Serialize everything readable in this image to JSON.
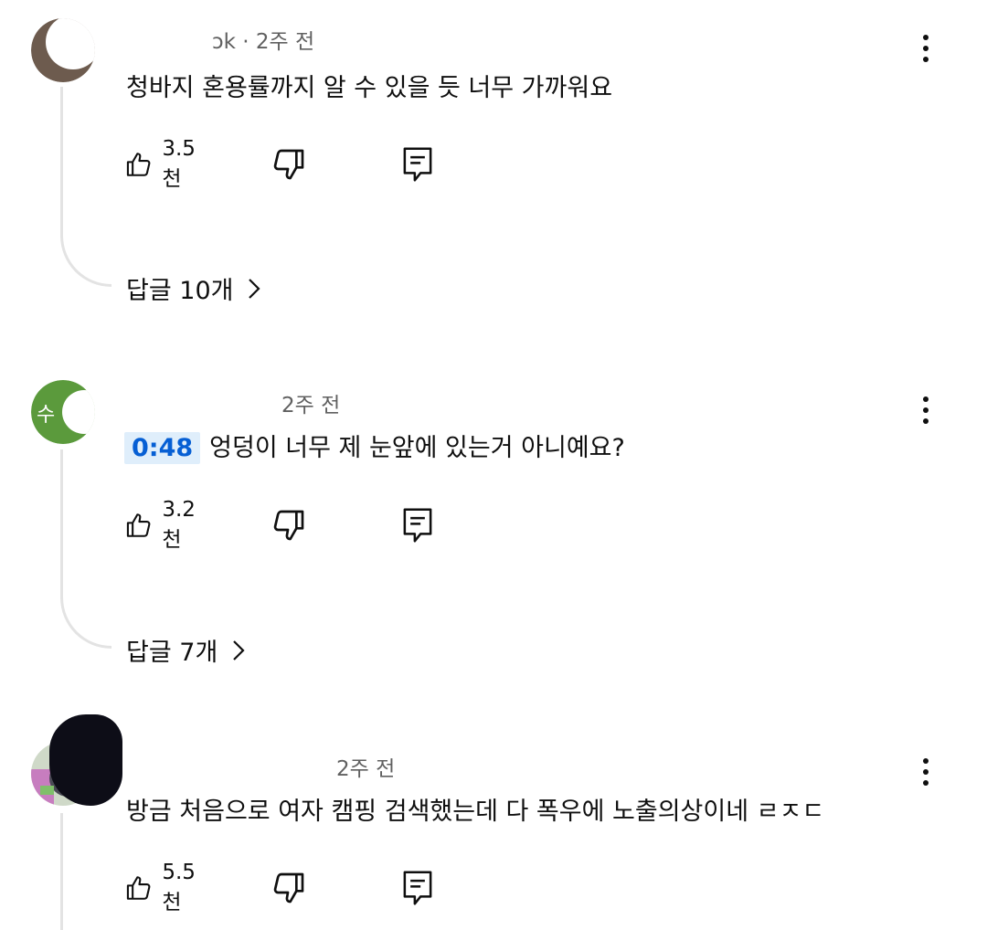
{
  "comments": [
    {
      "author_suffix": "ɔk",
      "separator": "·",
      "time": "2주 전",
      "text": "청바지 혼용률까지 알 수 있을 듯 너무 가까워요",
      "likes": "3.5천",
      "replies": "답글 10개"
    },
    {
      "avatar_char": "수",
      "time": "2주 전",
      "timestamp": "0:48",
      "text": "엉덩이 너무 제 눈앞에 있는거 아니예요?",
      "likes": "3.2천",
      "replies": "답글 7개"
    },
    {
      "time": "2주 전",
      "text": "방금 처음으로 여자 캠핑 검색했는데 다 폭우에 노출의상이네 ㄹㅈㄷ",
      "likes": "5.5천"
    }
  ],
  "icons": {
    "like": "thumbs-up-icon",
    "dislike": "thumbs-down-icon",
    "reply": "reply-icon",
    "more": "more-vert-icon",
    "chevron": "chevron-right-icon"
  },
  "colors": {
    "timestamp_bg": "#dfeefb",
    "timestamp_text": "#065fd4",
    "avatar2": "#5b9a3c"
  }
}
